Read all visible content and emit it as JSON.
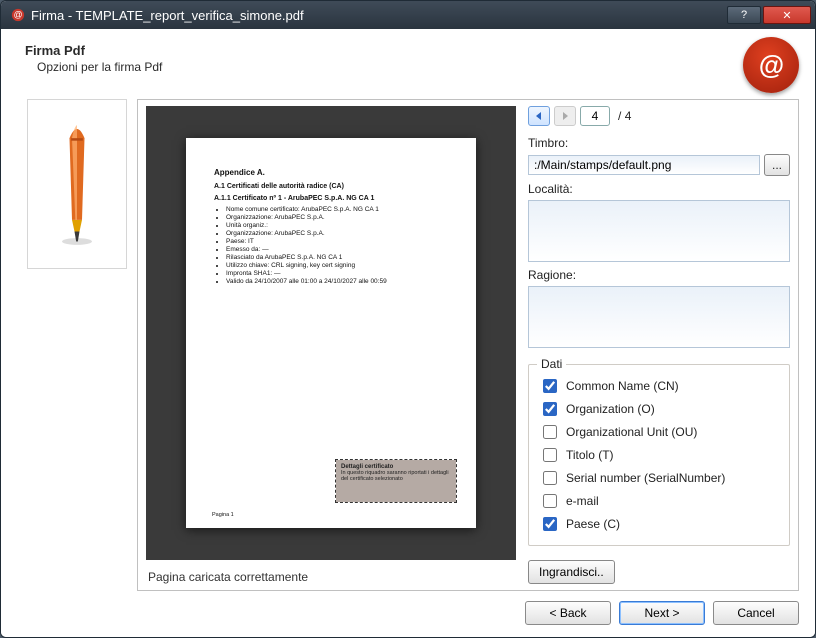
{
  "window": {
    "title": "Firma - TEMPLATE_report_verifica_simone.pdf"
  },
  "header": {
    "title": "Firma Pdf",
    "subtitle": "Opzioni per la firma Pdf",
    "seal_glyph": "@"
  },
  "nav": {
    "current_page": "4",
    "total_pages": "4",
    "page_sep": "/"
  },
  "stamp": {
    "label": "Timbro:",
    "value": ":/Main/stamps/default.png",
    "browse_label": "..."
  },
  "location": {
    "label": "Località:",
    "value": ""
  },
  "reason": {
    "label": "Ragione:",
    "value": ""
  },
  "dati": {
    "group_label": "Dati",
    "items": [
      {
        "label": "Common Name (CN)",
        "checked": true
      },
      {
        "label": "Organization (O)",
        "checked": true
      },
      {
        "label": "Organizational Unit (OU)",
        "checked": false
      },
      {
        "label": "Titolo (T)",
        "checked": false
      },
      {
        "label": "Serial number (SerialNumber)",
        "checked": false
      },
      {
        "label": "e-mail",
        "checked": false
      },
      {
        "label": "Paese (C)",
        "checked": true
      }
    ]
  },
  "zoom": {
    "label": "Ingrandisci.."
  },
  "status": {
    "text": "Pagina caricata correttamente"
  },
  "footer": {
    "back": "< Back",
    "next": "Next >",
    "cancel": "Cancel"
  },
  "doc": {
    "title": "Appendice A.",
    "sub1": "A.1 Certificati delle autorità radice (CA)",
    "sub2": "A.1.1 Certificato nº 1 - ArubaPEC S.p.A. NG CA 1",
    "bullets": [
      "Nome comune certificato: ArubaPEC S.p.A. NG CA 1",
      "Organizzazione: ArubaPEC S.p.A.",
      "Unità organiz.:",
      "Organizzazione: ArubaPEC S.p.A.",
      "Paese: IT",
      "Emesso da: —",
      "Rilasciato da ArubaPEC S.p.A. NG CA 1",
      "Utilizzo chiave: CRL signing, key cert signing",
      "Impronta SHA1: —",
      "Valido da 24/10/2007 alle 01:00 a 24/10/2027 alle 00:59"
    ],
    "sig_title": "Dettagli certificato",
    "sig_body": "In questo riquadro saranno riportati i dettagli del certificato selezionato",
    "page_footer": "Pagina 1"
  }
}
